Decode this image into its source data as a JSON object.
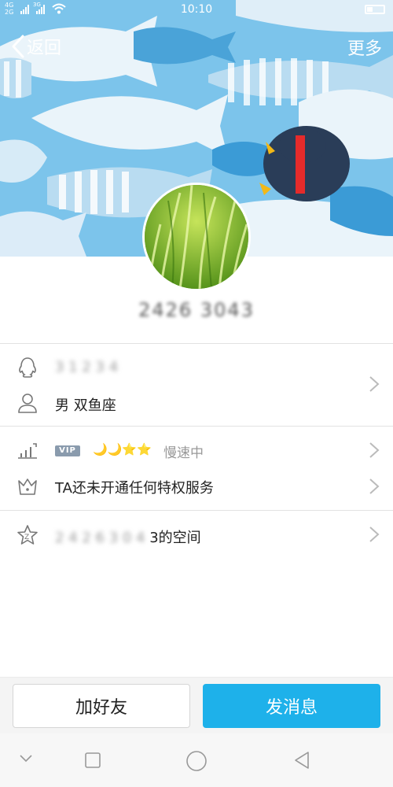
{
  "status_bar": {
    "network_top": "4G",
    "network_bottom": "2G",
    "network_3g": "3G",
    "time": "10:10"
  },
  "header": {
    "back_label": "返回",
    "more_label": "更多"
  },
  "profile": {
    "nickname": "2426 3043"
  },
  "info": {
    "account": "3 1 2 3 4",
    "gender_sign": "男  双鱼座",
    "vip_badge": "VIP",
    "vip_level_icons": "🌙🌙⭐⭐",
    "speed_status": "慢速中",
    "privilege_text": "TA还未开通任何特权服务",
    "zone_name_blurred": "2 4 2 6 3 0 4 ",
    "zone_suffix": "3的空间"
  },
  "actions": {
    "add_friend": "加好友",
    "send_message": "发消息"
  },
  "colors": {
    "accent": "#1eb1ea",
    "cover_bg": "#79c2ea"
  }
}
